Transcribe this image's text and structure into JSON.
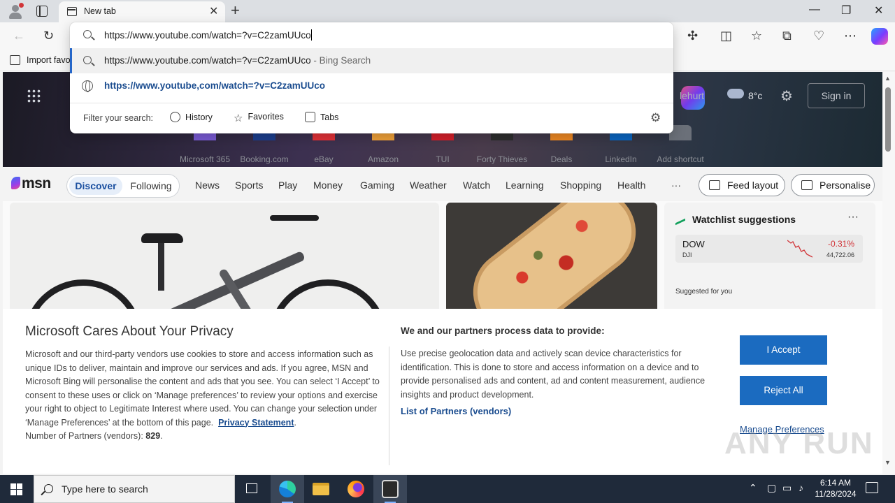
{
  "browser": {
    "tab_title": "New tab",
    "tab_close": "✕",
    "new_tab": "+",
    "window_controls": [
      "—",
      "❐",
      "✕"
    ],
    "favorites_bar_label": "Import favo"
  },
  "omnibox": {
    "value": "https://www.youtube.com/watch=?v=C2zamUUco",
    "suggestions": [
      {
        "text": "https://www.youtube.com/watch=?v=C2zamUUco",
        "suffix": " - Bing Search"
      },
      {
        "text": "https://www.youtube,com/watch=?v=C2zamUUco",
        "suffix": ""
      }
    ],
    "filter_label": "Filter your search:",
    "filters": [
      "History",
      "Favorites",
      "Tabs"
    ]
  },
  "newtab": {
    "weather": {
      "city": "lehurt",
      "temp": "8°c"
    },
    "sign_in": "Sign in",
    "shortcuts": [
      {
        "label": "Microsoft 365",
        "color": "#7b5cd6"
      },
      {
        "label": "Booking.com",
        "color": "#1d3f8f"
      },
      {
        "label": "eBay",
        "color": "#e53238"
      },
      {
        "label": "Amazon",
        "color": "#f2a33a"
      },
      {
        "label": "TUI",
        "color": "#d7202b"
      },
      {
        "label": "Forty Thieves",
        "color": "#2f2f2f"
      },
      {
        "label": "Deals",
        "color": "#f08a24"
      },
      {
        "label": "LinkedIn",
        "color": "#0a66c2"
      },
      {
        "label": "Add shortcut",
        "color": "#6b7079"
      }
    ],
    "msn_brand": "msn",
    "segments": [
      "Discover",
      "Following"
    ],
    "nav": [
      "News",
      "Sports",
      "Play",
      "Money",
      "Gaming",
      "Weather",
      "Watch",
      "Learning",
      "Shopping",
      "Health",
      "···"
    ],
    "feed_layout": "Feed layout",
    "personalise": "Personalise",
    "watchlist": {
      "title": "Watchlist suggestions",
      "more": "···",
      "stock": {
        "symbol": "DOW",
        "sub": "DJI",
        "change": "-0.31%",
        "price": "44,722.06"
      },
      "suggested": "Suggested for you"
    }
  },
  "privacy": {
    "title": "Microsoft Cares About Your Privacy",
    "body": "Microsoft and our third-party vendors use cookies to store and access information such as unique IDs to deliver, maintain and improve our services and ads. If you agree, MSN and Microsoft Bing will personalise the content and ads that you see. You can select ‘I Accept’ to consent to these uses or click on ‘Manage preferences’ to review your options and exercise your right to object to Legitimate Interest where used.  You can change your selection under ‘Manage Preferences’ at the bottom of this page.",
    "privacy_link": "Privacy Statement",
    "partners_count_label": "Number of Partners (vendors):",
    "partners_count": "829",
    "heading2": "We and our partners process data to provide:",
    "body2": "Use precise geolocation data and actively scan device characteristics for identification. This is done to store and access information on a device and to provide personalised ads and content, ad and content measurement, audience insights and product development.",
    "partners_link": "List of Partners (vendors)",
    "accept": "I Accept",
    "reject": "Reject All",
    "manage": "Manage Preferences"
  },
  "watermark": "ANY RUN",
  "taskbar": {
    "search_placeholder": "Type here to search",
    "time": "6:14 AM",
    "date": "11/28/2024"
  }
}
